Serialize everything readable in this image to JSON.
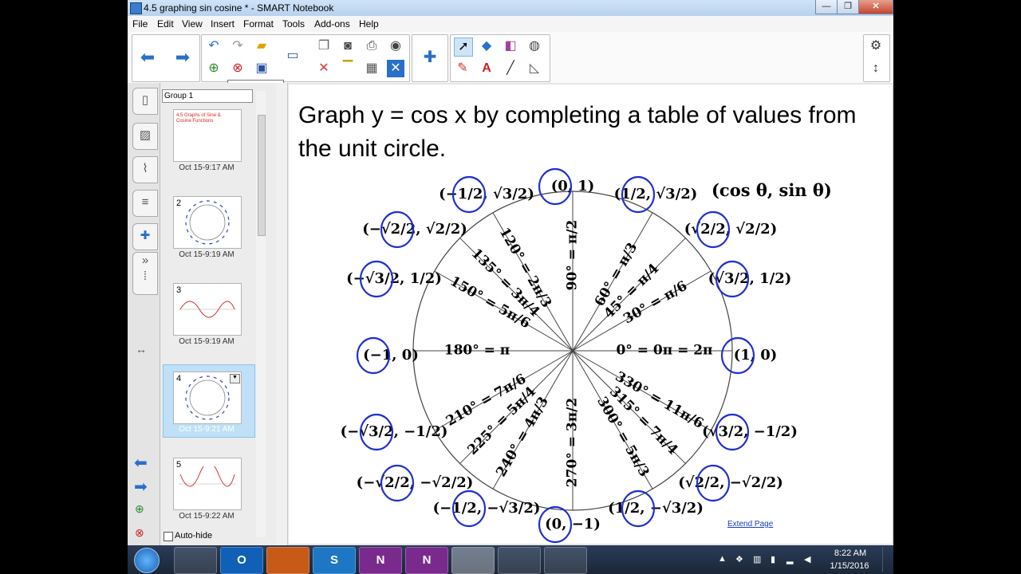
{
  "window": {
    "title": "4.5 graphing sin cosine * - SMART Notebook",
    "minimize": "—",
    "maximize": "❐",
    "close": "✕"
  },
  "menu": [
    "File",
    "Edit",
    "View",
    "Insert",
    "Format",
    "Tools",
    "Add-ons",
    "Help"
  ],
  "tooltip": "Delete Page",
  "sorter": {
    "group": "Group 1",
    "thumbs": [
      {
        "num": "",
        "date": "Oct 15-9:17 AM"
      },
      {
        "num": "2",
        "date": "Oct 15-9:19 AM"
      },
      {
        "num": "3",
        "date": "Oct 15-9:19 AM"
      },
      {
        "num": "4",
        "date": "Oct 15-9:21 AM"
      },
      {
        "num": "5",
        "date": "Oct 15-9:22 AM"
      }
    ],
    "thumb1_text": "4.5 Graphs of Sine & Cosine Functions",
    "autohide": "Auto-hide"
  },
  "page": {
    "title": "Graph y = cos x by completing a table of values from the unit circle.",
    "extend": "Extend Page",
    "legend": "(cos θ, sin θ)",
    "angles": {
      "a0": "0° = 0π = 2π",
      "a30": "30° = π/6",
      "a45": "45° = π/4",
      "a60": "60° = π/3",
      "a90": "90° = π/2",
      "a120": "120° = 2π/3",
      "a135": "135° = 3π/4",
      "a150": "150° = 5π/6",
      "a180": "180° = π",
      "a210": "210° = 7π/6",
      "a225": "225° = 5π/4",
      "a240": "240° = 4π/3",
      "a270": "270° = 3π/2",
      "a300": "300° = 5π/3",
      "a315": "315° = 7π/4",
      "a330": "330° = 11π/6"
    },
    "points": {
      "p0": "(1, 0)",
      "p30": "(√3/2, 1/2)",
      "p45": "(√2/2, √2/2)",
      "p60": "(1/2, √3/2)",
      "p90": "(0, 1)",
      "p120": "(−1/2, √3/2)",
      "p135": "(−√2/2, √2/2)",
      "p150": "(−√3/2, 1/2)",
      "p180": "(−1, 0)",
      "p210": "(−√3/2, −1/2)",
      "p225": "(−√2/2, −√2/2)",
      "p240": "(−1/2, −√3/2)",
      "p270": "(0, −1)",
      "p300": "(1/2, −√3/2)",
      "p315": "(√2/2, −√2/2)",
      "p330": "(√3/2, −1/2)"
    }
  },
  "taskbar": {
    "apps": [
      "",
      "O",
      "",
      "S",
      "N",
      "N",
      "",
      "",
      ""
    ],
    "time": "8:22 AM",
    "date": "1/15/2016"
  },
  "colors": {
    "ink": "#1f2fd0",
    "selection": "#bfe0f7",
    "taskbar": "#1b2738"
  }
}
